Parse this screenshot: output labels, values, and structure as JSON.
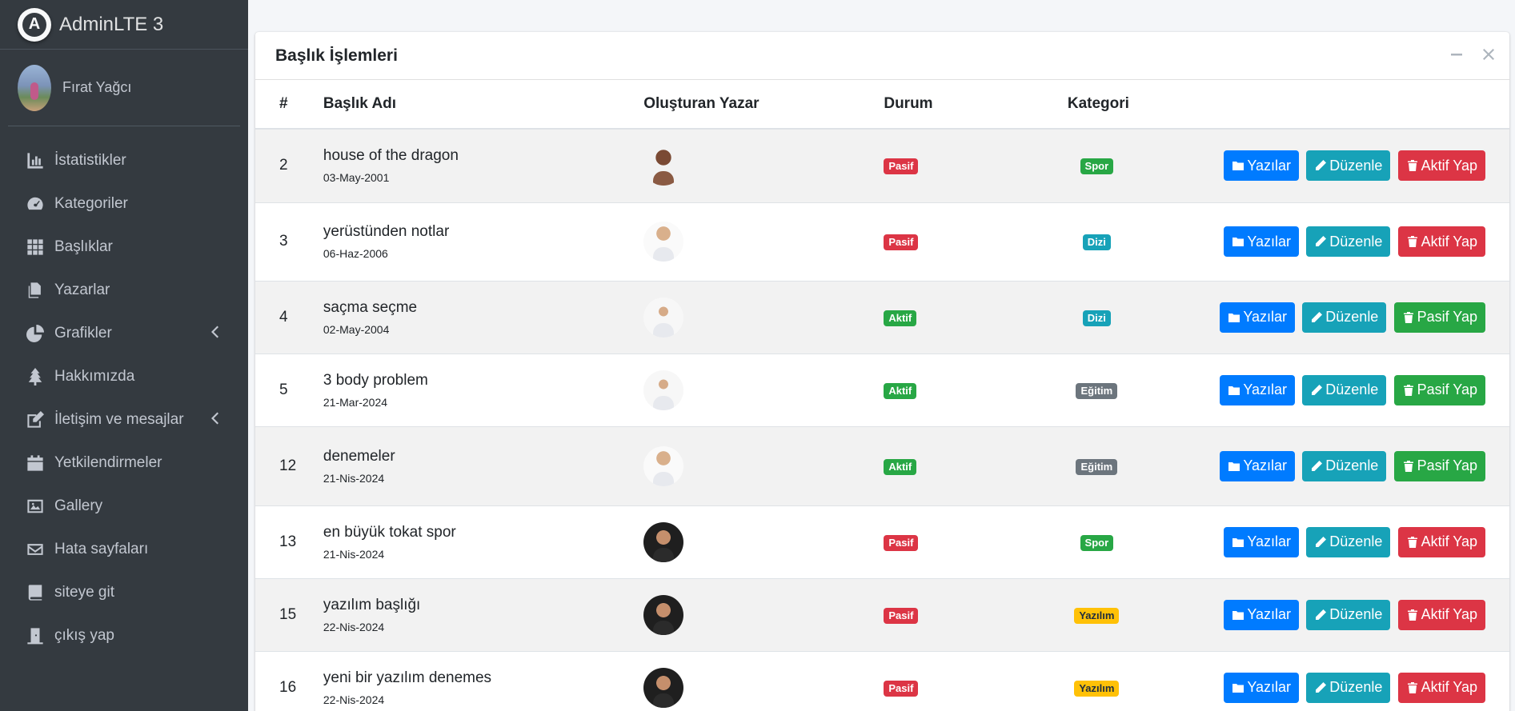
{
  "brand": {
    "name": "AdminLTE 3",
    "logo_letter": "A"
  },
  "user": {
    "name": "Fırat Yağcı"
  },
  "sidebar": {
    "items": [
      {
        "label": "İstatistikler",
        "icon": "chart-bar-icon"
      },
      {
        "label": "Kategoriler",
        "icon": "tachometer-icon"
      },
      {
        "label": "Başlıklar",
        "icon": "th-grid-icon"
      },
      {
        "label": "Yazarlar",
        "icon": "copy-icon"
      },
      {
        "label": "Grafikler",
        "icon": "chart-pie-icon",
        "has_arrow": true
      },
      {
        "label": "Hakkımızda",
        "icon": "tree-icon"
      },
      {
        "label": "İletişim ve mesajlar",
        "icon": "edit-icon",
        "has_arrow": true
      },
      {
        "label": "Yetkilendirmeler",
        "icon": "calendar-icon"
      },
      {
        "label": "Gallery",
        "icon": "image-icon"
      },
      {
        "label": "Hata sayfaları",
        "icon": "envelope-icon"
      },
      {
        "label": "siteye git",
        "icon": "book-icon"
      },
      {
        "label": "çıkış yap",
        "icon": "door-icon"
      }
    ]
  },
  "card": {
    "title": "Başlık İşlemleri"
  },
  "table": {
    "headers": {
      "num": "#",
      "title": "Başlık Adı",
      "author": "Oluşturan Yazar",
      "status": "Durum",
      "category": "Kategori"
    },
    "rows": [
      {
        "id": "2",
        "title": "house of the dragon",
        "date": "03-May-2001",
        "status": "Pasif",
        "category": "Spor",
        "action": "Aktif Yap"
      },
      {
        "id": "3",
        "title": "yerüstünden notlar",
        "date": "06-Haz-2006",
        "status": "Pasif",
        "category": "Dizi",
        "action": "Aktif Yap"
      },
      {
        "id": "4",
        "title": "saçma seçme",
        "date": "02-May-2004",
        "status": "Aktif",
        "category": "Dizi",
        "action": "Pasif Yap"
      },
      {
        "id": "5",
        "title": "3 body problem",
        "date": "21-Mar-2024",
        "status": "Aktif",
        "category": "Eğitim",
        "action": "Pasif Yap"
      },
      {
        "id": "12",
        "title": "denemeler",
        "date": "21-Nis-2024",
        "status": "Aktif",
        "category": "Eğitim",
        "action": "Pasif Yap"
      },
      {
        "id": "13",
        "title": "en büyük tokat spor",
        "date": "21-Nis-2024",
        "status": "Pasif",
        "category": "Spor",
        "action": "Aktif Yap"
      },
      {
        "id": "15",
        "title": "yazılım başlığı",
        "date": "22-Nis-2024",
        "status": "Pasif",
        "category": "Yazılım",
        "action": "Aktif Yap"
      },
      {
        "id": "16",
        "title": "yeni bir yazılım denemes",
        "date": "22-Nis-2024",
        "status": "Pasif",
        "category": "Yazılım",
        "action": "Aktif Yap"
      }
    ]
  },
  "buttons": {
    "posts": "Yazılar",
    "edit": "Düzenle"
  },
  "colors": {
    "primary": "#007bff",
    "info": "#17a2b8",
    "danger": "#dc3545",
    "success": "#28a745",
    "secondary": "#6c757d",
    "warning": "#ffc107",
    "sidebar": "#343a40"
  }
}
